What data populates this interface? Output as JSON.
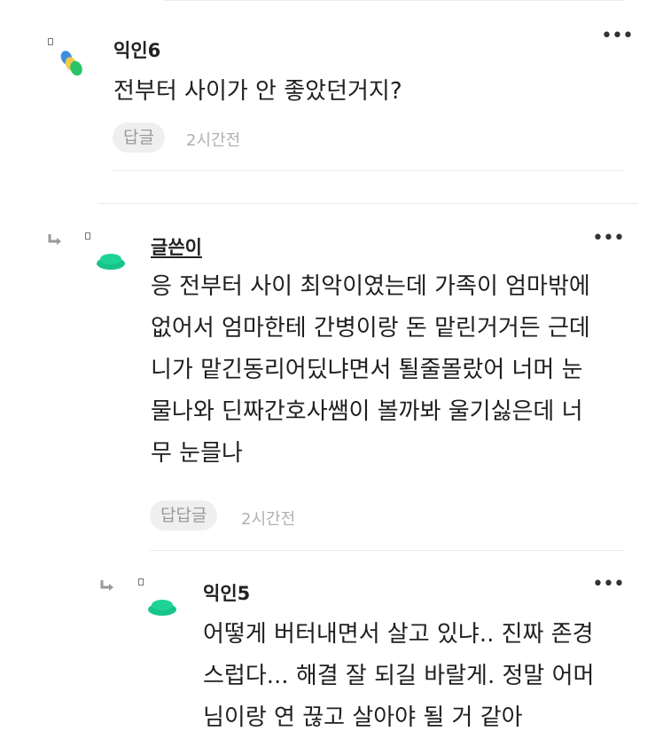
{
  "comments": [
    {
      "author": "익인6",
      "text": "전부터 사이가 안 좋았던거지?",
      "reply_label": "답글",
      "time": "2시간전",
      "more": "•••"
    },
    {
      "author": "글쓴이",
      "text": "응 전부터 사이 최악이였는데 가족이 엄마밖에\n없어서 엄마한테 간병이랑 돈 맡린거거든 근데\n니가 맡긴동리어딨냐면서 퇼줄몰랐어 너머 눈\n물나와 딘짜간호사쌤이 볼까봐 울기싫은데 너\n무 눈믈나",
      "reply_label": "답답글",
      "time": "2시간전",
      "more": "•••"
    },
    {
      "author": "익인5",
      "text": "어떻게 버터내면서 살고 있냐.. 진짜 존경\n스럽다... 해결 잘 되길 바랄게. 정말 어머\n님이랑 연 끊고 살아야 될 거 같아",
      "more": "•••"
    }
  ],
  "colors": {
    "accent_green": "#17c48a",
    "avatar_blue": "#3d8fe0",
    "avatar_yellow": "#f2c94c",
    "avatar_lime": "#2cc46b"
  }
}
